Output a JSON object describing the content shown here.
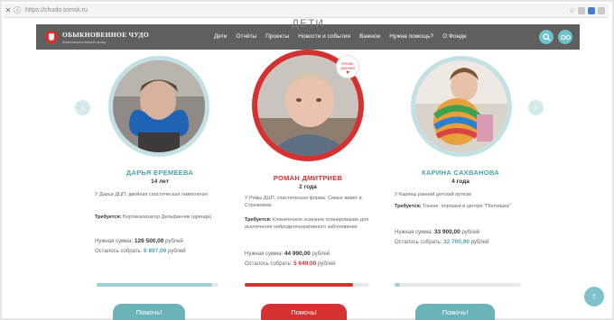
{
  "browser": {
    "close_glyph": "✕",
    "info_glyph": "ⓘ",
    "url": "https://chudo.tomsk.ru",
    "star_glyph": "☆"
  },
  "header": {
    "logo_title": "ОБЫКНОВЕННОЕ ЧУДО",
    "logo_subtitle": "благотворительный фонд",
    "page_heading": "ДЕТИ",
    "menu": [
      "Дети",
      "Отчёты",
      "Проекты",
      "Новости и события",
      "Важное",
      "Нужна помощь?",
      "О Фонде"
    ],
    "icons": [
      "search-icon",
      "glasses-icon"
    ]
  },
  "carousel": {
    "prev_glyph": "‹",
    "next_glyph": "›",
    "children": [
      {
        "name": "ДАРЬЯ ЕРЕМЕЕВА",
        "age": "14 лет",
        "description": "У Дарьи ДЦП, двойная спастическая гемиплегия",
        "requires_label": "Требуется:",
        "requires": "Вертикализатор Дельфинчик (аренда)",
        "needed_label": "Нужная сумма:",
        "needed": "126 500,00",
        "left_label": "Осталось собрать:",
        "left": "6 897,00",
        "currency": "рублей",
        "progress": 0.95,
        "button": "Помочь!"
      },
      {
        "name": "РОМАН ДМИТРИЕВ",
        "age": "2 года",
        "badge": "Очень срочно!",
        "description": "У Ромы ДЦП, спастическая форма. Семья живет в Стрежевом.",
        "requires_label": "Требуется:",
        "requires": "Клиническое эскизное планирование для исключения нейродегенеративного заболевания",
        "needed_label": "Нужная сумма:",
        "needed": "44 990,00",
        "left_label": "Осталось собрать:",
        "left": "5 649,00",
        "currency": "рублей",
        "progress": 0.87,
        "button": "Помочь!"
      },
      {
        "name": "КАРИНА САХВАНОВА",
        "age": "4 года",
        "description": "У Карины ранний детский аутизм",
        "requires_label": "Требуется:",
        "requires": "Тонкие: порошки в центре \"Полтишка\"",
        "needed_label": "Нужная сумма:",
        "needed": "33 900,00",
        "left_label": "Осталось собрать:",
        "left": "32 700,00",
        "currency": "рублей",
        "progress": 0.04,
        "button": "Помочь!"
      }
    ]
  },
  "scroll_top_glyph": "↑",
  "colors": {
    "accent": "#6ab3b8",
    "urgent": "#d63131",
    "header_bg": "#5f5f5f"
  }
}
